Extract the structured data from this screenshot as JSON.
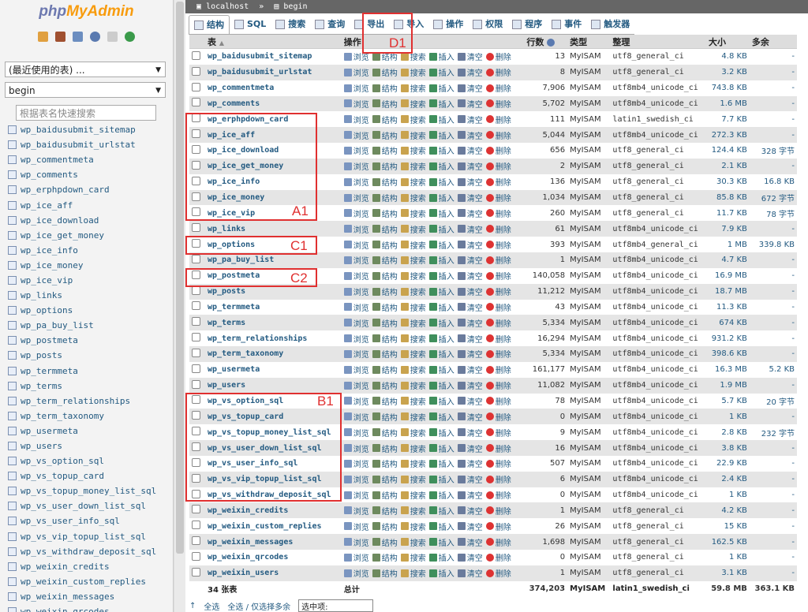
{
  "sidebar": {
    "logo": "phpMyAdmin",
    "recent_select": "(最近使用的表) ...",
    "db_select": "begin",
    "filter_placeholder": "根据表名快速搜索",
    "tables": [
      "wp_baidusubmit_sitemap",
      "wp_baidusubmit_urlstat",
      "wp_commentmeta",
      "wp_comments",
      "wp_erphpdown_card",
      "wp_ice_aff",
      "wp_ice_download",
      "wp_ice_get_money",
      "wp_ice_info",
      "wp_ice_money",
      "wp_ice_vip",
      "wp_links",
      "wp_options",
      "wp_pa_buy_list",
      "wp_postmeta",
      "wp_posts",
      "wp_termmeta",
      "wp_terms",
      "wp_term_relationships",
      "wp_term_taxonomy",
      "wp_usermeta",
      "wp_users",
      "wp_vs_option_sql",
      "wp_vs_topup_card",
      "wp_vs_topup_money_list_sql",
      "wp_vs_user_down_list_sql",
      "wp_vs_user_info_sql",
      "wp_vs_vip_topup_list_sql",
      "wp_vs_withdraw_deposit_sql",
      "wp_weixin_credits",
      "wp_weixin_custom_replies",
      "wp_weixin_messages",
      "wp_weixin_qrcodes"
    ]
  },
  "breadcrumb": {
    "server": "localhost",
    "db": "begin"
  },
  "tabs": [
    {
      "label": "结构",
      "icon": "structure-icon"
    },
    {
      "label": "SQL",
      "icon": "sql-icon"
    },
    {
      "label": "搜索",
      "icon": "search-icon"
    },
    {
      "label": "查询",
      "icon": "query-icon"
    },
    {
      "label": "导出",
      "icon": "export-icon"
    },
    {
      "label": "导入",
      "icon": "import-icon"
    },
    {
      "label": "操作",
      "icon": "wrench-icon"
    },
    {
      "label": "权限",
      "icon": "privileges-icon"
    },
    {
      "label": "程序",
      "icon": "routines-icon"
    },
    {
      "label": "事件",
      "icon": "events-icon"
    },
    {
      "label": "触发器",
      "icon": "triggers-icon"
    }
  ],
  "headers": {
    "table": "表",
    "actions": "操作",
    "rows": "行数",
    "type": "类型",
    "collation": "整理",
    "size": "大小",
    "overhead": "多余"
  },
  "actions": [
    "浏览",
    "结构",
    "搜索",
    "插入",
    "清空",
    "删除"
  ],
  "rows": [
    [
      "wp_baidusubmit_sitemap",
      "13",
      "MyISAM",
      "utf8_general_ci",
      "4.8 KB",
      "-"
    ],
    [
      "wp_baidusubmit_urlstat",
      "8",
      "MyISAM",
      "utf8_general_ci",
      "3.2 KB",
      "-"
    ],
    [
      "wp_commentmeta",
      "7,906",
      "MyISAM",
      "utf8mb4_unicode_ci",
      "743.8 KB",
      "-"
    ],
    [
      "wp_comments",
      "5,702",
      "MyISAM",
      "utf8mb4_unicode_ci",
      "1.6 MB",
      "-"
    ],
    [
      "wp_erphpdown_card",
      "111",
      "MyISAM",
      "latin1_swedish_ci",
      "7.7 KB",
      "-"
    ],
    [
      "wp_ice_aff",
      "5,044",
      "MyISAM",
      "utf8mb4_unicode_ci",
      "272.3 KB",
      "-"
    ],
    [
      "wp_ice_download",
      "656",
      "MyISAM",
      "utf8_general_ci",
      "124.4 KB",
      "328 字节"
    ],
    [
      "wp_ice_get_money",
      "2",
      "MyISAM",
      "utf8_general_ci",
      "2.1 KB",
      "-"
    ],
    [
      "wp_ice_info",
      "136",
      "MyISAM",
      "utf8_general_ci",
      "30.3 KB",
      "16.8 KB"
    ],
    [
      "wp_ice_money",
      "1,034",
      "MyISAM",
      "utf8_general_ci",
      "85.8 KB",
      "672 字节"
    ],
    [
      "wp_ice_vip",
      "260",
      "MyISAM",
      "utf8_general_ci",
      "11.7 KB",
      "78 字节"
    ],
    [
      "wp_links",
      "61",
      "MyISAM",
      "utf8mb4_unicode_ci",
      "7.9 KB",
      "-"
    ],
    [
      "wp_options",
      "393",
      "MyISAM",
      "utf8mb4_general_ci",
      "1 MB",
      "339.8 KB"
    ],
    [
      "wp_pa_buy_list",
      "1",
      "MyISAM",
      "utf8mb4_unicode_ci",
      "4.7 KB",
      "-"
    ],
    [
      "wp_postmeta",
      "140,058",
      "MyISAM",
      "utf8mb4_unicode_ci",
      "16.9 MB",
      "-"
    ],
    [
      "wp_posts",
      "11,212",
      "MyISAM",
      "utf8mb4_unicode_ci",
      "18.7 MB",
      "-"
    ],
    [
      "wp_termmeta",
      "43",
      "MyISAM",
      "utf8mb4_unicode_ci",
      "11.3 KB",
      "-"
    ],
    [
      "wp_terms",
      "5,334",
      "MyISAM",
      "utf8mb4_unicode_ci",
      "674 KB",
      "-"
    ],
    [
      "wp_term_relationships",
      "16,294",
      "MyISAM",
      "utf8mb4_unicode_ci",
      "931.2 KB",
      "-"
    ],
    [
      "wp_term_taxonomy",
      "5,334",
      "MyISAM",
      "utf8mb4_unicode_ci",
      "398.6 KB",
      "-"
    ],
    [
      "wp_usermeta",
      "161,177",
      "MyISAM",
      "utf8mb4_unicode_ci",
      "16.3 MB",
      "5.2 KB"
    ],
    [
      "wp_users",
      "11,082",
      "MyISAM",
      "utf8mb4_unicode_ci",
      "1.9 MB",
      "-"
    ],
    [
      "wp_vs_option_sql",
      "78",
      "MyISAM",
      "utf8mb4_unicode_ci",
      "5.7 KB",
      "20 字节"
    ],
    [
      "wp_vs_topup_card",
      "0",
      "MyISAM",
      "utf8mb4_unicode_ci",
      "1 KB",
      "-"
    ],
    [
      "wp_vs_topup_money_list_sql",
      "9",
      "MyISAM",
      "utf8mb4_unicode_ci",
      "2.8 KB",
      "232 字节"
    ],
    [
      "wp_vs_user_down_list_sql",
      "16",
      "MyISAM",
      "utf8mb4_unicode_ci",
      "3.8 KB",
      "-"
    ],
    [
      "wp_vs_user_info_sql",
      "507",
      "MyISAM",
      "utf8mb4_unicode_ci",
      "22.9 KB",
      "-"
    ],
    [
      "wp_vs_vip_topup_list_sql",
      "6",
      "MyISAM",
      "utf8mb4_unicode_ci",
      "2.4 KB",
      "-"
    ],
    [
      "wp_vs_withdraw_deposit_sql",
      "0",
      "MyISAM",
      "utf8mb4_unicode_ci",
      "1 KB",
      "-"
    ],
    [
      "wp_weixin_credits",
      "1",
      "MyISAM",
      "utf8_general_ci",
      "4.2 KB",
      "-"
    ],
    [
      "wp_weixin_custom_replies",
      "26",
      "MyISAM",
      "utf8_general_ci",
      "15 KB",
      "-"
    ],
    [
      "wp_weixin_messages",
      "1,698",
      "MyISAM",
      "utf8_general_ci",
      "162.5 KB",
      "-"
    ],
    [
      "wp_weixin_qrcodes",
      "0",
      "MyISAM",
      "utf8_general_ci",
      "1 KB",
      "-"
    ],
    [
      "wp_weixin_users",
      "1",
      "MyISAM",
      "utf8_general_ci",
      "3.1 KB",
      "-"
    ]
  ],
  "footer": {
    "count": "34 张表",
    "label": "总计",
    "rows": "374,203",
    "type": "MyISAM",
    "collation": "latin1_swedish_ci",
    "size": "59.8 MB",
    "overhead": "363.1 KB"
  },
  "bottom": {
    "check_all": "全选",
    "uncheck_all": "全选 / 仅选择多余",
    "with_selected": "选中项:"
  },
  "annotations": {
    "a1": "A1",
    "b1": "B1",
    "c1": "C1",
    "c2": "C2",
    "d1": "D1"
  }
}
